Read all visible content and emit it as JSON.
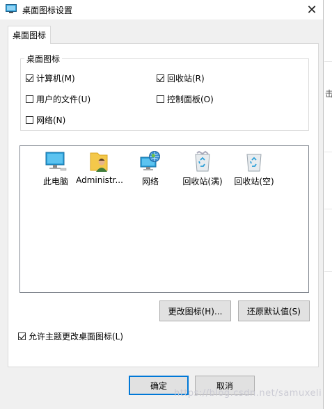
{
  "window": {
    "title": "桌面图标设置"
  },
  "tab": {
    "label": "桌面图标"
  },
  "group": {
    "label": "桌面图标",
    "checkboxes": [
      {
        "label": "计算机(M)",
        "checked": true
      },
      {
        "label": "回收站(R)",
        "checked": true
      },
      {
        "label": "用户的文件(U)",
        "checked": false
      },
      {
        "label": "控制面板(O)",
        "checked": false
      },
      {
        "label": "网络(N)",
        "checked": false
      }
    ]
  },
  "icons": [
    {
      "label": "此电脑",
      "icon": "computer-icon"
    },
    {
      "label": "Administr...",
      "icon": "user-folder-icon"
    },
    {
      "label": "网络",
      "icon": "network-icon"
    },
    {
      "label": "回收站(满)",
      "icon": "recycle-bin-full-icon"
    },
    {
      "label": "回收站(空)",
      "icon": "recycle-bin-empty-icon"
    }
  ],
  "buttons": {
    "change_icon": "更改图标(H)...",
    "restore_default": "还原默认值(S)",
    "ok": "确定",
    "cancel": "取消"
  },
  "allow_themes": {
    "label": "允许主题更改桌面图标(L)",
    "checked": true
  },
  "watermark": "https://blog.csdn.net/samuxeli",
  "background": {
    "side_char": "击"
  },
  "colors": {
    "accent": "#0078d7",
    "folder": "#f4c84a",
    "screen": "#2a9fd8"
  }
}
